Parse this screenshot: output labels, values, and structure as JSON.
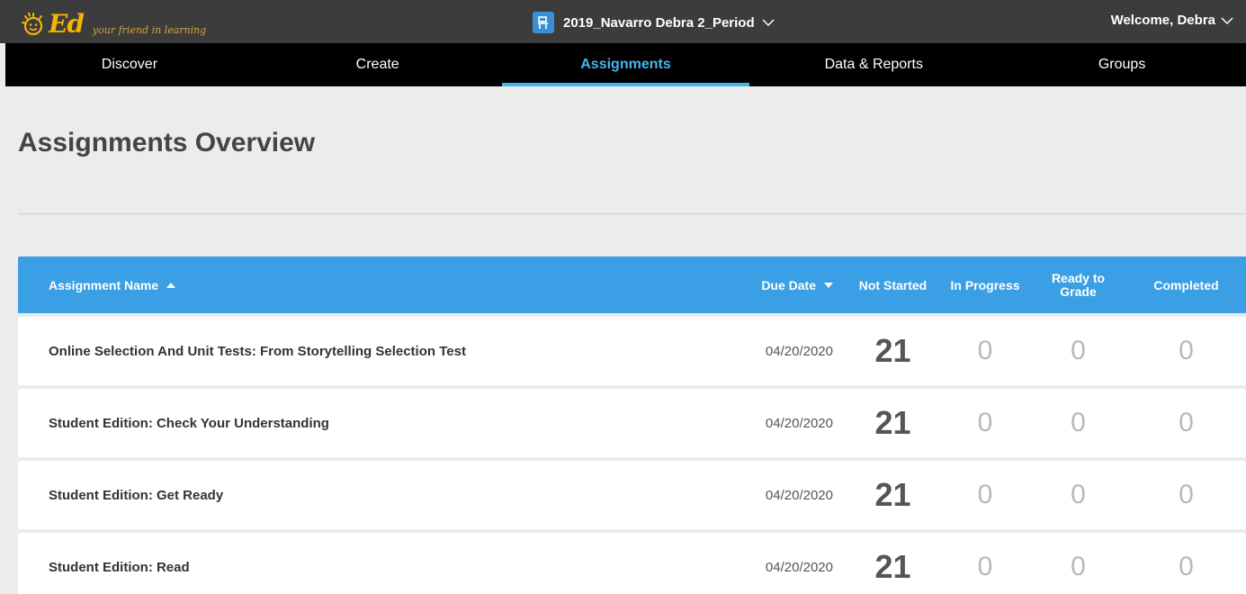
{
  "header": {
    "logo_text": "Ed",
    "tagline": "your friend in learning",
    "class_name": "2019_Navarro Debra 2_Period",
    "welcome": "Welcome, Debra"
  },
  "nav": {
    "items": [
      {
        "label": "Discover"
      },
      {
        "label": "Create"
      },
      {
        "label": "Assignments"
      },
      {
        "label": "Data & Reports"
      },
      {
        "label": "Groups"
      }
    ],
    "active_index": 2
  },
  "page": {
    "title": "Assignments Overview"
  },
  "table": {
    "columns": {
      "name": "Assignment Name",
      "due": "Due Date",
      "not_started": "Not Started",
      "in_progress": "In Progress",
      "ready_to_grade_line1": "Ready to",
      "ready_to_grade_line2": "Grade",
      "completed": "Completed"
    },
    "rows": [
      {
        "name": "Online Selection And Unit Tests: From Storytelling Selection Test",
        "due": "04/20/2020",
        "not_started": "21",
        "in_progress": "0",
        "ready_to_grade": "0",
        "completed": "0"
      },
      {
        "name": "Student Edition: Check Your Understanding",
        "due": "04/20/2020",
        "not_started": "21",
        "in_progress": "0",
        "ready_to_grade": "0",
        "completed": "0"
      },
      {
        "name": "Student Edition: Get Ready",
        "due": "04/20/2020",
        "not_started": "21",
        "in_progress": "0",
        "ready_to_grade": "0",
        "completed": "0"
      },
      {
        "name": "Student Edition: Read",
        "due": "04/20/2020",
        "not_started": "21",
        "in_progress": "0",
        "ready_to_grade": "0",
        "completed": "0"
      }
    ]
  },
  "colors": {
    "topbar": "#3c3c3c",
    "nav": "#000000",
    "accent": "#47b4ee",
    "table_header": "#3a9fe4",
    "logo": "#f4b400"
  },
  "icons": {
    "logo": "sun-smiley-icon",
    "class": "classroom-desk-icon",
    "dropdown": "chevron-down-icon",
    "sort_asc": "caret-up-icon",
    "sort_desc": "caret-down-icon"
  }
}
